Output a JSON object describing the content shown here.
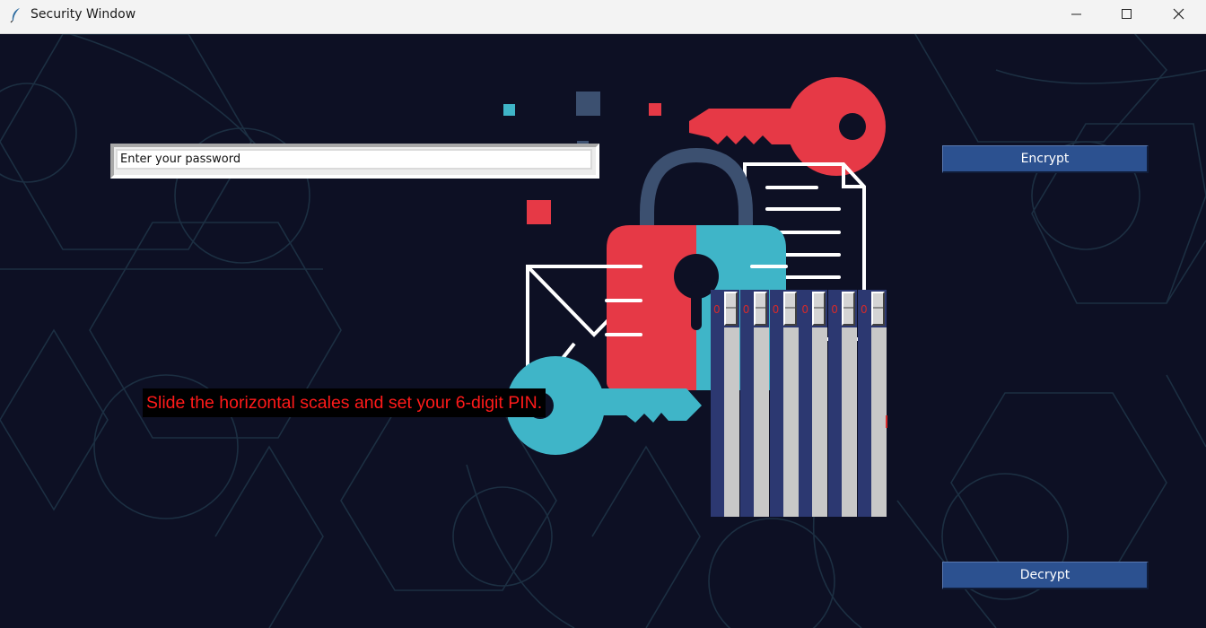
{
  "window": {
    "title": "Security Window",
    "icon": "feather-icon",
    "controls": [
      "minimize-icon",
      "maximize-icon",
      "close-icon"
    ]
  },
  "password": {
    "value": "Enter your password"
  },
  "buttons": {
    "encrypt_label": "Encrypt",
    "decrypt_label": "Decrypt"
  },
  "pin": {
    "instruction": "Slide the horizontal scales and set your 6-digit PIN.",
    "digits": [
      "0",
      "0",
      "0",
      "0",
      "0",
      "0"
    ]
  },
  "colors": {
    "background": "#0d1024",
    "button": "#2c5190",
    "scale": "#2c3871",
    "instruction_text": "#ff1a1a",
    "key_red": "#e63946",
    "key_teal": "#3fb5c8"
  }
}
